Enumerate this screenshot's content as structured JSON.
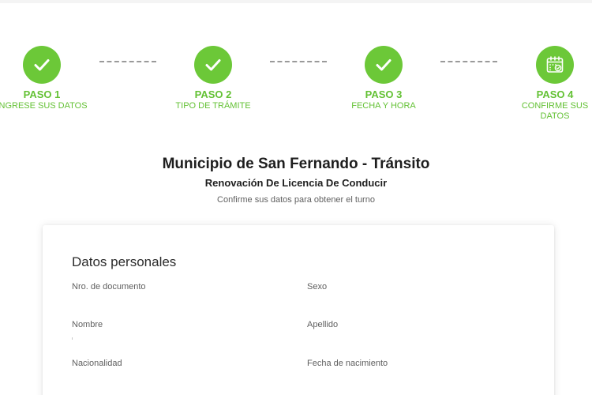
{
  "colors": {
    "accent": "#6cc838",
    "accent_text": "#63c134",
    "title_text": "#1e1e1e",
    "muted_text": "#616161",
    "connector": "#9a9a9a"
  },
  "stepper": {
    "steps": [
      {
        "number": "PASO 1",
        "label": "INGRESE SUS DATOS",
        "icon": "check-icon",
        "status": "completed"
      },
      {
        "number": "PASO 2",
        "label": "TIPO DE TRÁMITE",
        "icon": "check-icon",
        "status": "completed"
      },
      {
        "number": "PASO 3",
        "label": "FECHA Y HORA",
        "icon": "check-icon",
        "status": "completed"
      },
      {
        "number": "PASO 4",
        "label": "CONFIRME SUS DATOS",
        "icon": "calendar-check-icon",
        "status": "current"
      }
    ]
  },
  "header": {
    "title": "Municipio de San Fernando - Tránsito",
    "subtitle": "Renovación De Licencia De Conducir",
    "description": "Confirme sus datos para obtener el turno"
  },
  "card": {
    "title": "Datos personales",
    "fields": {
      "document": {
        "label": "Nro. de documento",
        "value": ""
      },
      "sex": {
        "label": "Sexo",
        "value": ""
      },
      "first_name": {
        "label": "Nombre",
        "value": ""
      },
      "last_name": {
        "label": "Apellido",
        "value": ""
      },
      "nationality": {
        "label": "Nacionalidad",
        "value": ""
      },
      "birth_date": {
        "label": "Fecha de nacimiento",
        "value": ""
      }
    }
  }
}
